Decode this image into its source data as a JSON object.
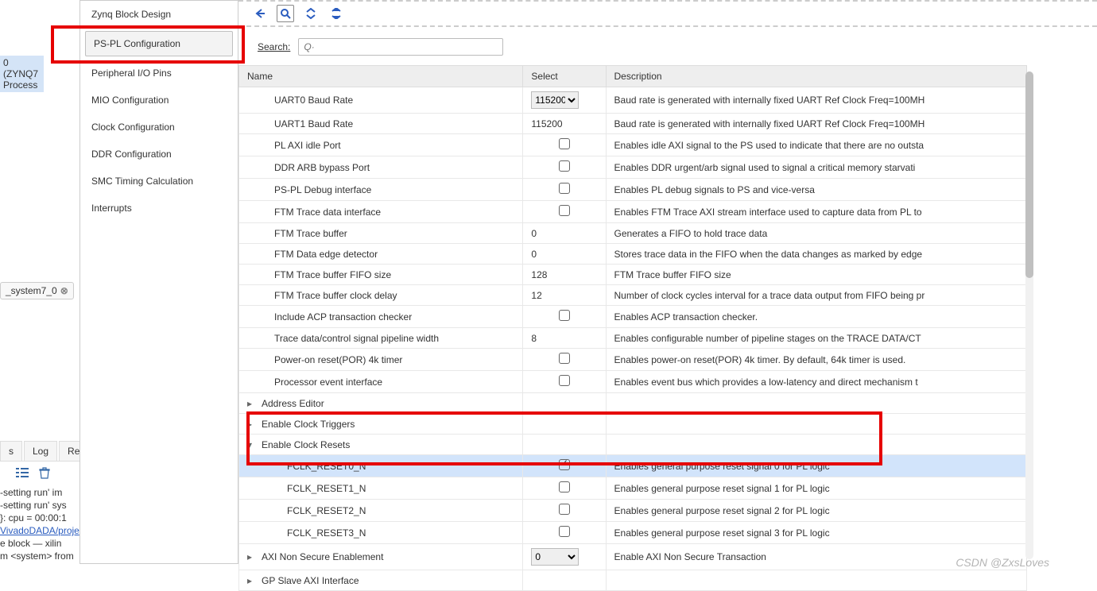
{
  "left": {
    "zynq_label": "0 (ZYNQ7 Process",
    "system_tag": "_system7_0",
    "tabs": [
      "s",
      "Log",
      "Repo"
    ],
    "console_lines": [
      {
        "t": "-setting run' im",
        "c": ""
      },
      {
        "t": "-setting run' sys",
        "c": ""
      },
      {
        "t": "}: cpu = 00:00:1",
        "c": ""
      },
      {
        "t": "VivadoDADA/proje",
        "c": "blue"
      },
      {
        "t": "e block — xilin",
        "c": ""
      },
      {
        "t": "m <system> from",
        "c": ""
      }
    ]
  },
  "sidebar": {
    "items": [
      "Zynq Block Design",
      "PS-PL Configuration",
      "Peripheral I/O Pins",
      "MIO Configuration",
      "Clock Configuration",
      "DDR Configuration",
      "SMC Timing Calculation",
      "Interrupts"
    ]
  },
  "search": {
    "label": "Search:",
    "placeholder": "Q·"
  },
  "table": {
    "headers": [
      "Name",
      "Select",
      "Description"
    ],
    "rows": [
      {
        "name": "UART0 Baud Rate",
        "indent": 1,
        "select_type": "dropdown",
        "select": "115200",
        "desc": "Baud rate is generated with internally fixed UART Ref Clock Freq=100MH"
      },
      {
        "name": "UART1 Baud Rate",
        "indent": 1,
        "select_type": "text",
        "select": "115200",
        "desc": "Baud rate is generated with internally fixed UART Ref Clock Freq=100MH"
      },
      {
        "name": "PL AXI idle Port",
        "indent": 1,
        "select_type": "checkbox",
        "checked": false,
        "desc": "Enables idle AXI signal to the PS used to indicate that there are no outsta"
      },
      {
        "name": "DDR ARB bypass Port",
        "indent": 1,
        "select_type": "checkbox",
        "checked": false,
        "desc": "Enables DDR urgent/arb signal used to signal a critical memory starvati"
      },
      {
        "name": "PS-PL Debug interface",
        "indent": 1,
        "select_type": "checkbox",
        "checked": false,
        "desc": "Enables PL debug signals to PS and vice-versa"
      },
      {
        "name": "FTM Trace data interface",
        "indent": 1,
        "select_type": "checkbox",
        "checked": false,
        "desc": "Enables FTM Trace AXI stream interface used to capture data from PL to"
      },
      {
        "name": "FTM Trace buffer",
        "indent": 1,
        "select_type": "text",
        "select": "0",
        "desc": "Generates a FIFO to hold trace data"
      },
      {
        "name": "FTM Data edge detector",
        "indent": 1,
        "select_type": "text",
        "select": "0",
        "desc": "Stores trace data in the FIFO when the data changes as marked by edge"
      },
      {
        "name": "FTM Trace buffer FIFO size",
        "indent": 1,
        "select_type": "text",
        "select": "128",
        "desc": "FTM Trace buffer FIFO size"
      },
      {
        "name": "FTM Trace buffer clock delay",
        "indent": 1,
        "select_type": "text",
        "select": "12",
        "desc": "Number of clock cycles interval for a trace data output from FIFO being pr"
      },
      {
        "name": "Include ACP transaction checker",
        "indent": 1,
        "select_type": "checkbox",
        "checked": false,
        "desc": " Enables ACP transaction checker."
      },
      {
        "name": "Trace data/control signal pipeline width",
        "indent": 1,
        "select_type": "text",
        "select": "8",
        "desc": "Enables configurable number of pipeline stages on the TRACE DATA/CT"
      },
      {
        "name": "Power-on reset(POR) 4k timer",
        "indent": 1,
        "select_type": "checkbox",
        "checked": false,
        "desc": "Enables power-on reset(POR) 4k timer. By default, 64k timer is used."
      },
      {
        "name": "Processor event interface",
        "indent": 1,
        "select_type": "checkbox",
        "checked": false,
        "desc": "Enables event bus which provides a low-latency and direct mechanism t"
      },
      {
        "name": "Address Editor",
        "indent": 0,
        "expander": ">",
        "desc": ""
      },
      {
        "name": "Enable Clock Triggers",
        "indent": 0,
        "expander": ">",
        "desc": ""
      },
      {
        "name": "Enable Clock Resets",
        "indent": 0,
        "expander": "v",
        "desc": ""
      },
      {
        "name": "FCLK_RESET0_N",
        "indent": 2,
        "select_type": "checkbox",
        "checked": true,
        "desc": "Enables general purpose reset signal 0 for PL logic",
        "selected": true
      },
      {
        "name": "FCLK_RESET1_N",
        "indent": 2,
        "select_type": "checkbox",
        "checked": false,
        "desc": "Enables general purpose reset signal 1 for PL logic"
      },
      {
        "name": "FCLK_RESET2_N",
        "indent": 2,
        "select_type": "checkbox",
        "checked": false,
        "desc": "Enables general purpose reset signal 2 for PL logic"
      },
      {
        "name": "FCLK_RESET3_N",
        "indent": 2,
        "select_type": "checkbox",
        "checked": false,
        "desc": "Enables general purpose reset signal 3 for PL logic"
      },
      {
        "name": "AXI Non Secure Enablement",
        "indent": 0,
        "expander": ">",
        "select_type": "dropdown",
        "select": "0",
        "desc": "Enable AXI Non Secure Transaction"
      },
      {
        "name": "GP Slave AXI Interface",
        "indent": 0,
        "expander": ">",
        "desc": ""
      }
    ]
  },
  "watermark": "CSDN @ZxsLoves"
}
